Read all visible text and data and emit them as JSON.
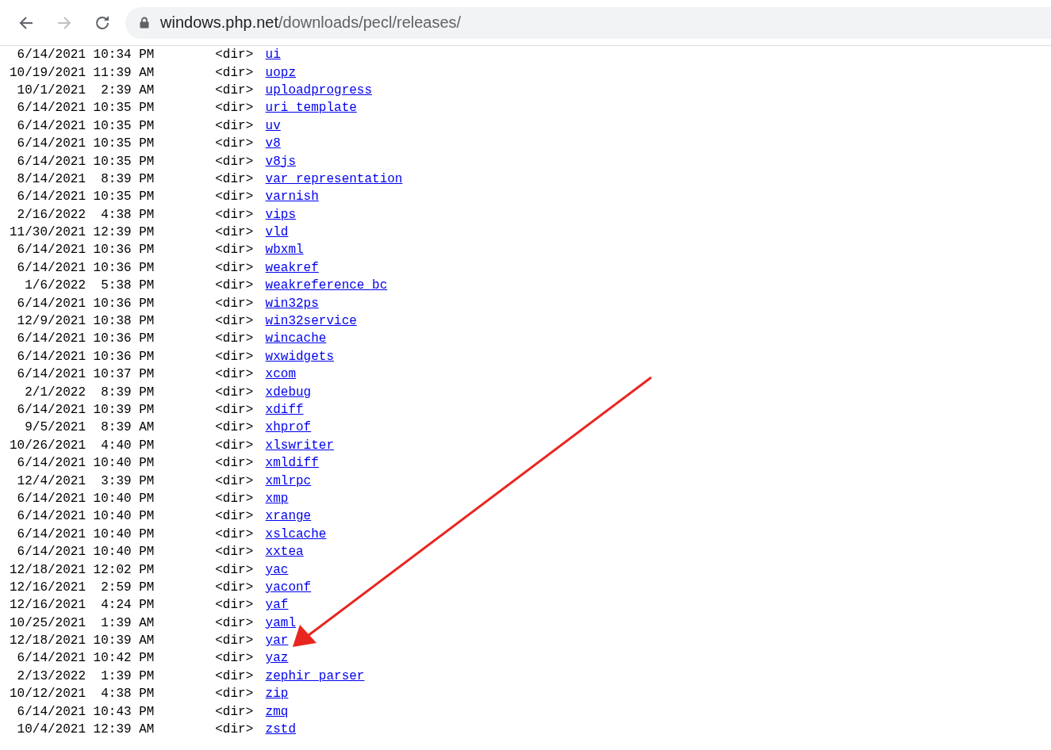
{
  "toolbar": {
    "address": {
      "host": "windows.php.net",
      "path": "/downloads/pecl/releases/"
    }
  },
  "listing": {
    "rows": [
      {
        "date": "6/14/2021",
        "time": "10:34 PM",
        "entry_type": "<dir>",
        "name": "ui"
      },
      {
        "date": "10/19/2021",
        "time": "11:39 AM",
        "entry_type": "<dir>",
        "name": "uopz"
      },
      {
        "date": "10/1/2021",
        "time": "2:39 AM",
        "entry_type": "<dir>",
        "name": "uploadprogress"
      },
      {
        "date": "6/14/2021",
        "time": "10:35 PM",
        "entry_type": "<dir>",
        "name": "uri_template"
      },
      {
        "date": "6/14/2021",
        "time": "10:35 PM",
        "entry_type": "<dir>",
        "name": "uv"
      },
      {
        "date": "6/14/2021",
        "time": "10:35 PM",
        "entry_type": "<dir>",
        "name": "v8"
      },
      {
        "date": "6/14/2021",
        "time": "10:35 PM",
        "entry_type": "<dir>",
        "name": "v8js"
      },
      {
        "date": "8/14/2021",
        "time": "8:39 PM",
        "entry_type": "<dir>",
        "name": "var_representation"
      },
      {
        "date": "6/14/2021",
        "time": "10:35 PM",
        "entry_type": "<dir>",
        "name": "varnish"
      },
      {
        "date": "2/16/2022",
        "time": "4:38 PM",
        "entry_type": "<dir>",
        "name": "vips"
      },
      {
        "date": "11/30/2021",
        "time": "12:39 PM",
        "entry_type": "<dir>",
        "name": "vld"
      },
      {
        "date": "6/14/2021",
        "time": "10:36 PM",
        "entry_type": "<dir>",
        "name": "wbxml"
      },
      {
        "date": "6/14/2021",
        "time": "10:36 PM",
        "entry_type": "<dir>",
        "name": "weakref"
      },
      {
        "date": "1/6/2022",
        "time": "5:38 PM",
        "entry_type": "<dir>",
        "name": "weakreference_bc"
      },
      {
        "date": "6/14/2021",
        "time": "10:36 PM",
        "entry_type": "<dir>",
        "name": "win32ps"
      },
      {
        "date": "12/9/2021",
        "time": "10:38 PM",
        "entry_type": "<dir>",
        "name": "win32service"
      },
      {
        "date": "6/14/2021",
        "time": "10:36 PM",
        "entry_type": "<dir>",
        "name": "wincache"
      },
      {
        "date": "6/14/2021",
        "time": "10:36 PM",
        "entry_type": "<dir>",
        "name": "wxwidgets"
      },
      {
        "date": "6/14/2021",
        "time": "10:37 PM",
        "entry_type": "<dir>",
        "name": "xcom"
      },
      {
        "date": "2/1/2022",
        "time": "8:39 PM",
        "entry_type": "<dir>",
        "name": "xdebug"
      },
      {
        "date": "6/14/2021",
        "time": "10:39 PM",
        "entry_type": "<dir>",
        "name": "xdiff"
      },
      {
        "date": "9/5/2021",
        "time": "8:39 AM",
        "entry_type": "<dir>",
        "name": "xhprof"
      },
      {
        "date": "10/26/2021",
        "time": "4:40 PM",
        "entry_type": "<dir>",
        "name": "xlswriter"
      },
      {
        "date": "6/14/2021",
        "time": "10:40 PM",
        "entry_type": "<dir>",
        "name": "xmldiff"
      },
      {
        "date": "12/4/2021",
        "time": "3:39 PM",
        "entry_type": "<dir>",
        "name": "xmlrpc"
      },
      {
        "date": "6/14/2021",
        "time": "10:40 PM",
        "entry_type": "<dir>",
        "name": "xmp"
      },
      {
        "date": "6/14/2021",
        "time": "10:40 PM",
        "entry_type": "<dir>",
        "name": "xrange"
      },
      {
        "date": "6/14/2021",
        "time": "10:40 PM",
        "entry_type": "<dir>",
        "name": "xslcache"
      },
      {
        "date": "6/14/2021",
        "time": "10:40 PM",
        "entry_type": "<dir>",
        "name": "xxtea"
      },
      {
        "date": "12/18/2021",
        "time": "12:02 PM",
        "entry_type": "<dir>",
        "name": "yac"
      },
      {
        "date": "12/16/2021",
        "time": "2:59 PM",
        "entry_type": "<dir>",
        "name": "yaconf"
      },
      {
        "date": "12/16/2021",
        "time": "4:24 PM",
        "entry_type": "<dir>",
        "name": "yaf"
      },
      {
        "date": "10/25/2021",
        "time": "1:39 AM",
        "entry_type": "<dir>",
        "name": "yaml"
      },
      {
        "date": "12/18/2021",
        "time": "10:39 AM",
        "entry_type": "<dir>",
        "name": "yar"
      },
      {
        "date": "6/14/2021",
        "time": "10:42 PM",
        "entry_type": "<dir>",
        "name": "yaz"
      },
      {
        "date": "2/13/2022",
        "time": "1:39 PM",
        "entry_type": "<dir>",
        "name": "zephir_parser"
      },
      {
        "date": "10/12/2021",
        "time": "4:38 PM",
        "entry_type": "<dir>",
        "name": "zip"
      },
      {
        "date": "6/14/2021",
        "time": "10:43 PM",
        "entry_type": "<dir>",
        "name": "zmq"
      },
      {
        "date": "10/4/2021",
        "time": "12:39 AM",
        "entry_type": "<dir>",
        "name": "zstd"
      }
    ]
  }
}
